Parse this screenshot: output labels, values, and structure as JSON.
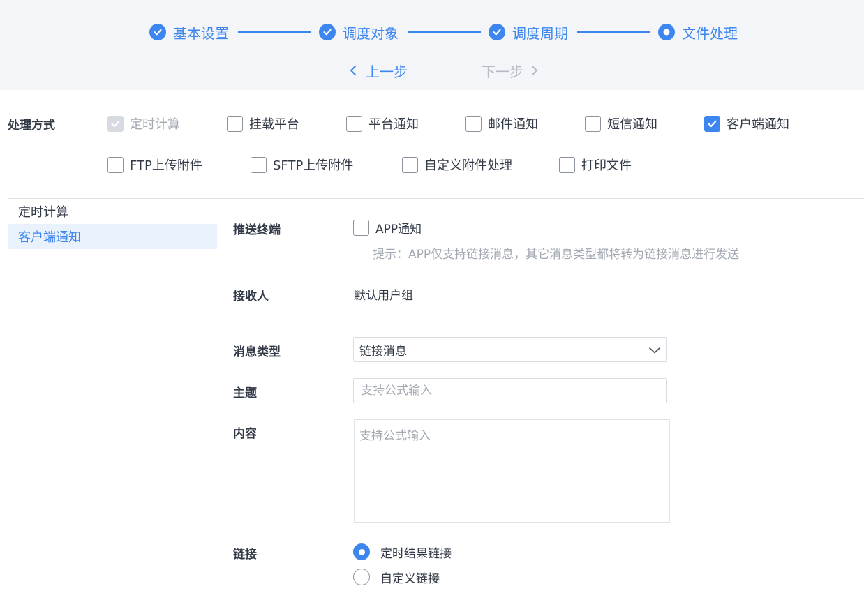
{
  "stepper": {
    "steps": [
      {
        "label": "基本设置",
        "state": "done"
      },
      {
        "label": "调度对象",
        "state": "done"
      },
      {
        "label": "调度周期",
        "state": "done"
      },
      {
        "label": "文件处理",
        "state": "current"
      }
    ],
    "prev_label": "上一步",
    "next_label": "下一步"
  },
  "methods": {
    "title": "处理方式",
    "options": [
      {
        "label": "定时计算",
        "checked": true,
        "disabled": true
      },
      {
        "label": "挂载平台",
        "checked": false
      },
      {
        "label": "平台通知",
        "checked": false
      },
      {
        "label": "邮件通知",
        "checked": false
      },
      {
        "label": "短信通知",
        "checked": false
      },
      {
        "label": "客户端通知",
        "checked": true
      },
      {
        "label": "FTP上传附件",
        "checked": false
      },
      {
        "label": "SFTP上传附件",
        "checked": false
      },
      {
        "label": "自定义附件处理",
        "checked": false
      },
      {
        "label": "打印文件",
        "checked": false
      }
    ]
  },
  "sidebar": {
    "items": [
      {
        "label": "定时计算",
        "active": false
      },
      {
        "label": "客户端通知",
        "active": true
      }
    ]
  },
  "form": {
    "terminal": {
      "label": "推送终端",
      "option": "APP通知",
      "checked": false,
      "hint": "提示：APP仅支持链接消息，其它消息类型都将转为链接消息进行发送"
    },
    "receiver": {
      "label": "接收人",
      "value": "默认用户组"
    },
    "message_type": {
      "label": "消息类型",
      "value": "链接消息"
    },
    "subject": {
      "label": "主题",
      "placeholder": "支持公式输入",
      "value": ""
    },
    "content": {
      "label": "内容",
      "placeholder": "支持公式输入",
      "value": ""
    },
    "link": {
      "label": "链接",
      "options": [
        {
          "label": "定时结果链接",
          "selected": true
        },
        {
          "label": "自定义链接",
          "selected": false
        }
      ]
    }
  },
  "colors": {
    "accent": "#3d86f0",
    "muted": "#a3a9b2",
    "text": "#333a47",
    "header_bg": "#f3f5f8"
  }
}
